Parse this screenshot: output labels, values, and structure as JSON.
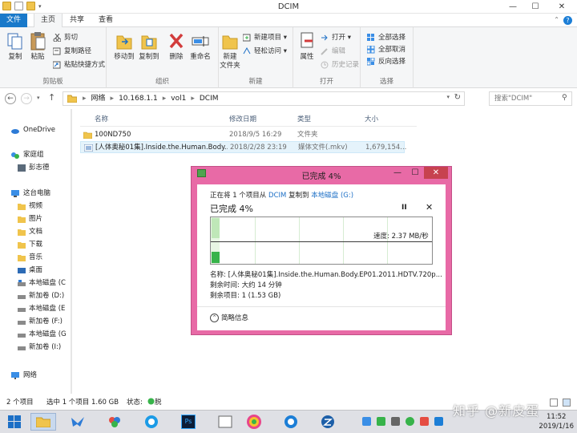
{
  "window": {
    "title": "DCIM",
    "minimize_glyph": "—",
    "maximize_glyph": "☐",
    "close_glyph": "✕"
  },
  "ribbon_tabs": [
    {
      "label": "文件"
    },
    {
      "label": "主页"
    },
    {
      "label": "共享"
    },
    {
      "label": "查看"
    }
  ],
  "ribbon": {
    "clipboard": {
      "label": "剪贴板",
      "copy": "复制",
      "paste": "粘贴",
      "cut": "剪切",
      "copy_path": "复制路径",
      "paste_shortcut": "粘贴快捷方式"
    },
    "organize": {
      "label": "组织",
      "move_to": "移动到",
      "copy_to": "复制到",
      "delete": "删除",
      "rename": "重命名"
    },
    "new": {
      "label": "新建",
      "new_folder_line1": "新建",
      "new_folder_line2": "文件夹",
      "new_item": "新建项目 ▾",
      "easy_access": "轻松访问 ▾"
    },
    "open": {
      "label": "打开",
      "properties": "属性",
      "open": "打开 ▾",
      "edit": "编辑",
      "history": "历史记录"
    },
    "select": {
      "label": "选择",
      "select_all": "全部选择",
      "select_none": "全部取消",
      "invert": "反向选择"
    }
  },
  "address": {
    "crumbs": [
      "网络",
      "▸",
      "10.168.1.1",
      "▸",
      "vol1",
      "▸",
      "DCIM"
    ],
    "search_placeholder": "搜索\"DCIM\""
  },
  "nav": {
    "items": [
      {
        "label": "OneDrive"
      },
      {
        "label": "家庭组"
      },
      {
        "label": "彭志德"
      },
      {
        "label": "这台电脑"
      },
      {
        "label": "视频"
      },
      {
        "label": "图片"
      },
      {
        "label": "文档"
      },
      {
        "label": "下载"
      },
      {
        "label": "音乐"
      },
      {
        "label": "桌面"
      },
      {
        "label": "本地磁盘 (C"
      },
      {
        "label": "新加卷 (D:)"
      },
      {
        "label": "本地磁盘 (E"
      },
      {
        "label": "新加卷 (F:)"
      },
      {
        "label": "本地磁盘 (G"
      },
      {
        "label": "新加卷 (I:)"
      },
      {
        "label": "网络"
      }
    ]
  },
  "files": {
    "headers": {
      "name": "名称",
      "date": "修改日期",
      "type": "类型",
      "size": "大小"
    },
    "rows": [
      {
        "name": "100ND750",
        "date": "2018/9/5 16:29",
        "type": "文件夹",
        "size": ""
      },
      {
        "name": "[人体奥秘01集].Inside.the.Human.Body....",
        "date": "2018/2/28 23:19",
        "type": "媒体文件(.mkv)",
        "size": "1,679,154..."
      }
    ]
  },
  "status": {
    "count": "2 个项目",
    "selected": "选中 1 个项目  1.60 GB",
    "state": "状态: ",
    "offline": "脱机"
  },
  "dialog": {
    "title": "已完成 4%",
    "line_prefix": "正在将 1 个项目从",
    "source": "DCIM",
    "middle": "复制到",
    "dest": "本地磁盘 (G:)",
    "percent": "已完成 4%",
    "pause": "II",
    "close": "✕",
    "progress": 0.04,
    "speed": "速度: 2.37 MB/秒",
    "name": "名称: [人体奥秘01集].Inside.the.Human.Body.EP01.2011.HDTV.720p...",
    "time_left": "剩余时间: 大约 14 分钟",
    "items_left": "剩余项目: 1 (1.53 GB)",
    "details": "简略信息"
  },
  "taskbar": {
    "clock_time": "11:52",
    "clock_date": "2019/1/16",
    "watermark": "知乎 @新皮蛋"
  },
  "colors": {
    "file_tab": "#1979ca",
    "dialog_frame": "#e86aa6",
    "progress_green": "#37b34a",
    "link_blue": "#1c6fc6"
  }
}
